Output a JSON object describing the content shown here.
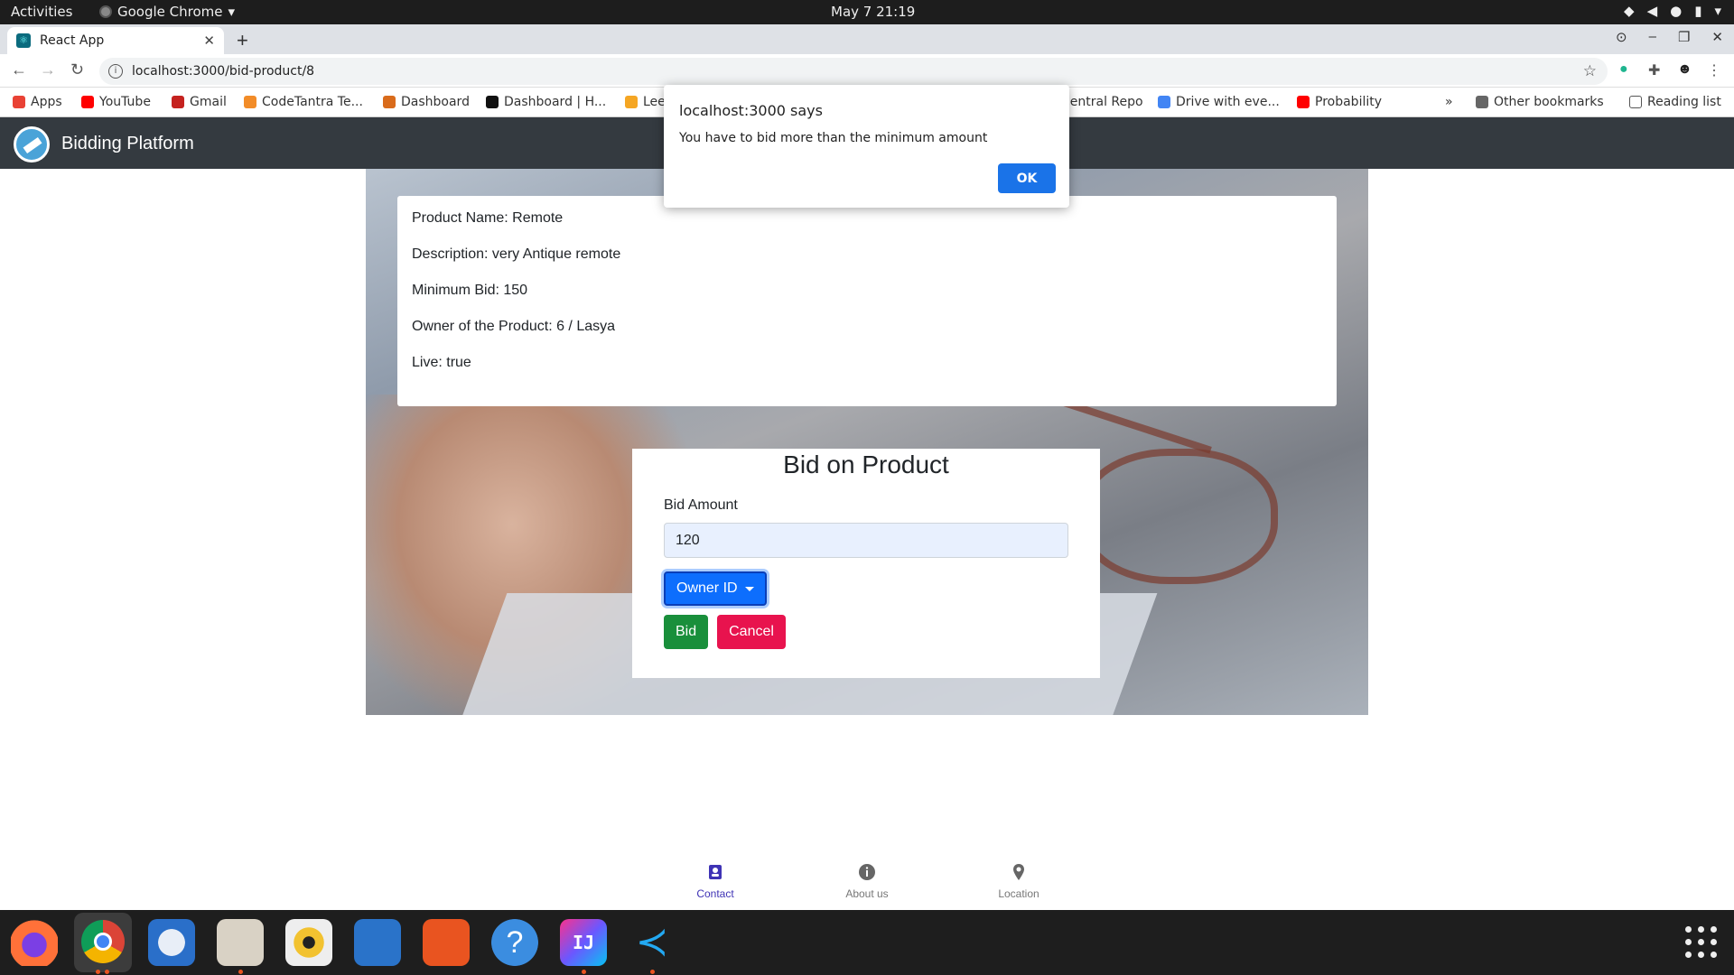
{
  "system_bar": {
    "activities": "Activities",
    "app_name": "Google Chrome",
    "clock": "May 7  21:19"
  },
  "browser": {
    "tab_title": "React App",
    "url": "localhost:3000/bid-product/8",
    "bookmarks": [
      {
        "label": "Apps",
        "color": "#e94235"
      },
      {
        "label": "YouTube",
        "color": "#ff0000"
      },
      {
        "label": "Gmail",
        "color": "#c5221f"
      },
      {
        "label": "CodeTantra Te...",
        "color": "#f28c28"
      },
      {
        "label": "Dashboard",
        "color": "#d96b1b"
      },
      {
        "label": "Dashboard | H...",
        "color": "#111111"
      },
      {
        "label": "Lee",
        "color": "#f5a623"
      },
      {
        "label": "Central Repo",
        "color": "#4285f4"
      },
      {
        "label": "Drive with eve...",
        "color": "#4285f4"
      },
      {
        "label": "Probability",
        "color": "#ff0000"
      }
    ],
    "overflow": "»",
    "other_bookmarks": "Other bookmarks",
    "reading_list": "Reading list"
  },
  "app": {
    "brand": "Bidding Platform"
  },
  "product": {
    "name_line": "Product Name: Remote",
    "description_line": "Description: very Antique remote",
    "min_bid_line": "Minimum Bid: 150",
    "owner_line": "Owner of the Product: 6 / Lasya",
    "live_line": "Live: true"
  },
  "bid_form": {
    "title": "Bid on Product",
    "amount_label": "Bid Amount",
    "amount_value": "120",
    "owner_dropdown": "Owner ID",
    "bid_button": "Bid",
    "cancel_button": "Cancel"
  },
  "alert": {
    "title": "localhost:3000 says",
    "message": "You have to bid more than the minimum amount",
    "ok_button": "OK"
  },
  "bottom_nav": [
    {
      "label": "Contact",
      "icon": "contact-icon",
      "active": true
    },
    {
      "label": "About us",
      "icon": "info-icon",
      "active": false
    },
    {
      "label": "Location",
      "icon": "location-pin-icon",
      "active": false
    }
  ],
  "colors": {
    "navbar": "#343a40",
    "primary": "#0d6efd",
    "success": "#198f3b",
    "danger": "#e8134e",
    "active_nav": "#3f33b5"
  }
}
